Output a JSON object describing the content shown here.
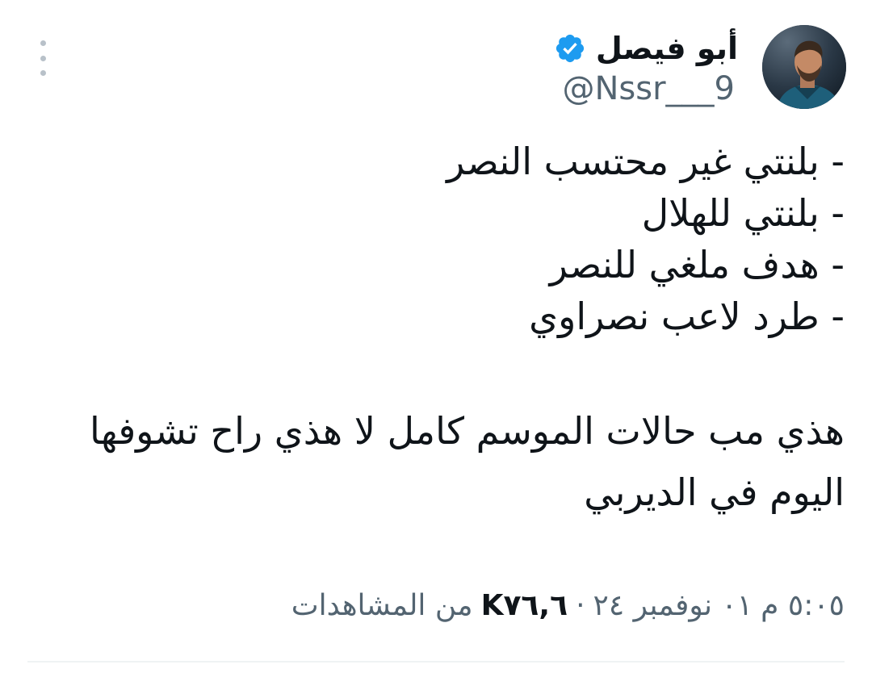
{
  "author": {
    "display_name": "أبو فيصل",
    "handle": "@Nssr___9",
    "avatar_icon": "profile-photo",
    "verified_icon": "verified-badge-icon",
    "verified_color": "#1d9bf0"
  },
  "menu": {
    "icon": "more-vertical-icon"
  },
  "tweet": {
    "lines": [
      "- بلنتي غير محتسب النصر",
      "- بلنتي للهلال",
      "- هدف ملغي للنصر",
      "- طرد لاعب نصراوي"
    ],
    "paragraph_line1": "هذي مب حالات الموسم كامل لا هذي راح تشوفها",
    "paragraph_line2": "اليوم في الديربي"
  },
  "meta": {
    "time": "٥:٠٥ م",
    "date": "٠١ نوفمبر ٢٤",
    "separator": "·",
    "views_count": "K٧٦,٦",
    "views_label": "من المشاهدات"
  },
  "colors": {
    "text_primary": "#0f1419",
    "text_secondary": "#536471",
    "divider": "#eff3f4"
  }
}
